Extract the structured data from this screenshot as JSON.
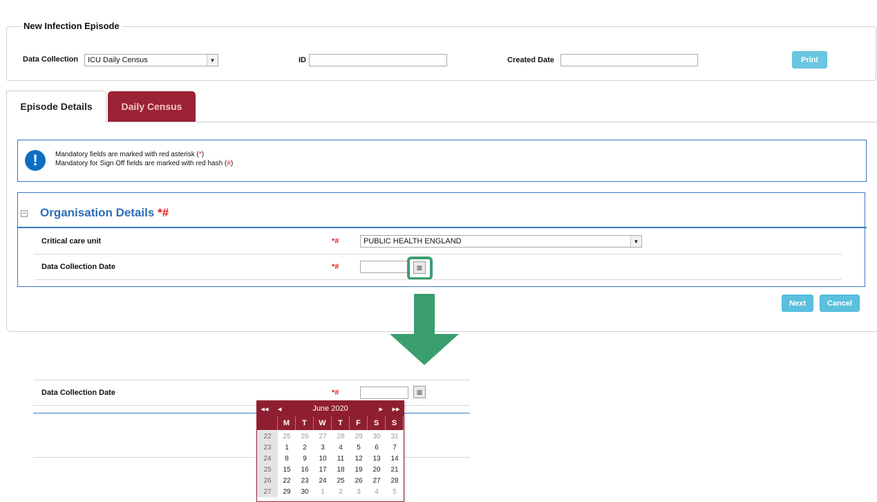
{
  "episode": {
    "legend": "New Infection Episode",
    "data_collection_label": "Data Collection",
    "data_collection_value": "ICU Daily Census",
    "id_label": "ID",
    "id_value": "",
    "created_date_label": "Created Date",
    "created_date_value": "",
    "print_label": "Print"
  },
  "tabs": [
    {
      "label": "Episode Details",
      "active": true
    },
    {
      "label": "Daily Census",
      "active": false
    }
  ],
  "info": {
    "line1_prefix": "Mandatory fields are marked with red asterisk (",
    "line1_mark": "*",
    "line1_suffix": ")",
    "line2_prefix": "Mandatory for Sign Off fields are marked with red hash (",
    "line2_mark": "#",
    "line2_suffix": ")"
  },
  "org": {
    "title": "Organisation Details",
    "title_mark": "*#",
    "critical_care_label": "Critical care unit",
    "critical_care_req": "*#",
    "critical_care_value": "PUBLIC HEALTH ENGLAND",
    "dcd_label": "Data Collection Date",
    "dcd_req": "*#",
    "dcd_value": ""
  },
  "actions": {
    "next_label": "Next",
    "cancel_label": "Cancel"
  },
  "zoom": {
    "dcd_label": "Data Collection Date",
    "dcd_req": "*#"
  },
  "calendar": {
    "month_label": "June 2020",
    "nav_prev_year": "◂◂",
    "nav_prev_month": "◂",
    "nav_next_month": "▸",
    "nav_next_year": "▸▸",
    "days_of_week": [
      "M",
      "T",
      "W",
      "T",
      "F",
      "S",
      "S"
    ],
    "weeks": [
      {
        "week": "22",
        "days": [
          "25",
          "26",
          "27",
          "28",
          "29",
          "30",
          "31"
        ],
        "current": [
          false,
          false,
          false,
          false,
          false,
          false,
          false
        ]
      },
      {
        "week": "23",
        "days": [
          "1",
          "2",
          "3",
          "4",
          "5",
          "6",
          "7"
        ],
        "current": [
          true,
          true,
          true,
          true,
          true,
          true,
          true
        ]
      },
      {
        "week": "24",
        "days": [
          "8",
          "9",
          "10",
          "11",
          "12",
          "13",
          "14"
        ],
        "current": [
          true,
          true,
          true,
          true,
          true,
          true,
          true
        ]
      },
      {
        "week": "25",
        "days": [
          "15",
          "16",
          "17",
          "18",
          "19",
          "20",
          "21"
        ],
        "current": [
          true,
          true,
          true,
          true,
          true,
          true,
          true
        ]
      },
      {
        "week": "26",
        "days": [
          "22",
          "23",
          "24",
          "25",
          "26",
          "27",
          "28"
        ],
        "current": [
          true,
          true,
          true,
          true,
          true,
          true,
          true
        ]
      },
      {
        "week": "27",
        "days": [
          "29",
          "30",
          "1",
          "2",
          "3",
          "4",
          "5"
        ],
        "current": [
          true,
          true,
          false,
          false,
          false,
          false,
          false
        ]
      }
    ]
  },
  "colors": {
    "accent_red": "#8f1f30",
    "accent_blue": "#3a78c3",
    "button_blue": "#5bc0de",
    "highlight_green": "#3a9e6e"
  }
}
